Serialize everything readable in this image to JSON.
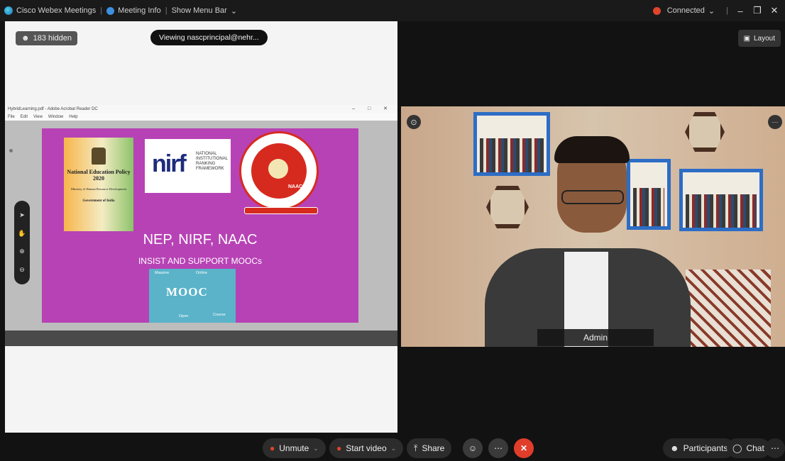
{
  "titlebar": {
    "app_name": "Cisco Webex Meetings",
    "meeting_info": "Meeting Info",
    "show_menu_bar": "Show Menu Bar",
    "connection_status": "Connected",
    "sep1": "|",
    "sep2": "|",
    "sep3": "|"
  },
  "left_pane": {
    "hidden_count": "183 hidden",
    "viewing_label": "Viewing nascprincipal@nehr..."
  },
  "shared_app": {
    "title": "HybridLearning.pdf - Adobe Acrobat Reader DC",
    "menu": [
      "File",
      "Edit",
      "View",
      "Window",
      "Help"
    ]
  },
  "slide": {
    "nep_title": "National Education Policy 2020",
    "nep_ministry": "Ministry of Human Resource Development",
    "nep_gov": "Government of India",
    "nirf_logo": "nirf",
    "nirf_text": [
      "NATIONAL",
      "INSTITUTIONAL",
      "RANKING",
      "FRAMEWORK"
    ],
    "naac_label": "NAAC",
    "title": "NEP, NIRF, NAAC",
    "subtitle": "INSIST AND SUPPORT MOOCs",
    "mooc_title": "MOOC",
    "mooc_labels": [
      "Massive",
      "Online",
      "Open",
      "Course"
    ]
  },
  "video": {
    "participant_name": "Admin"
  },
  "layout_button": "Layout",
  "controls": {
    "unmute": "Unmute",
    "start_video": "Start video",
    "share": "Share",
    "participants": "Participants",
    "chat": "Chat"
  },
  "colors": {
    "slide_bg": "#b742b5",
    "leave": "#e13d2b",
    "shelf": "#2d6dc5"
  }
}
